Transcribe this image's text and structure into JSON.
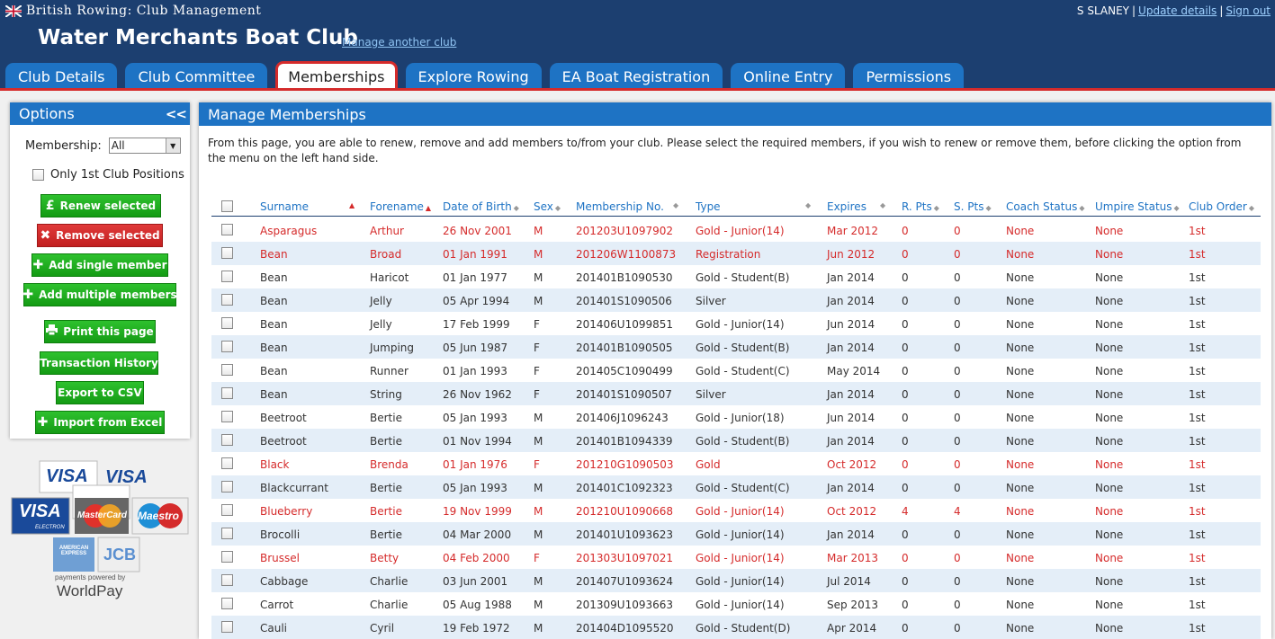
{
  "header": {
    "brand": "British Rowing: Club Management",
    "user_name": "S SLANEY",
    "update_details": "Update details",
    "sign_out": "Sign out",
    "club_name": "Water Merchants Boat Club",
    "manage_another": "Manage another club"
  },
  "tabs": [
    {
      "label": "Club Details"
    },
    {
      "label": "Club Committee"
    },
    {
      "label": "Memberships",
      "active": true
    },
    {
      "label": "Explore Rowing"
    },
    {
      "label": "EA Boat Registration"
    },
    {
      "label": "Online Entry"
    },
    {
      "label": "Permissions"
    }
  ],
  "options": {
    "title": "Options",
    "collapse": "<<",
    "membership_label": "Membership:",
    "membership_value": "All",
    "only_first_club": "Only 1st Club Positions",
    "buttons": {
      "renew": "Renew selected",
      "remove": "Remove selected",
      "add_single": "Add single member",
      "add_multiple": "Add multiple members",
      "print": "Print this page",
      "transactions": "Transaction History",
      "export": "Export to CSV",
      "import": "Import from Excel"
    }
  },
  "cards": {
    "visa1": "VISA",
    "visa2": "VISA",
    "visa_electron": "VISA",
    "electron": "ELECTRON",
    "mastercard": "MasterCard",
    "maestro": "Maestro",
    "amex": "AMERICAN EXPRESS",
    "jcb": "JCB",
    "powered_by": "payments powered by",
    "worldpay": "WorldPay"
  },
  "colors": {
    "header_bg": "#1c3f70",
    "tab_bg": "#1e73c4",
    "accent_red": "#d52b2b",
    "button_green": "#1fae1f"
  },
  "manage": {
    "title": "Manage Memberships",
    "intro": "From this page, you are able to renew, remove and add members to/from your club. Please select the required members, if you wish to renew or remove them, before clicking the option from the menu on the left hand side.",
    "columns": [
      "Surname",
      "Forename",
      "Date of Birth",
      "Sex",
      "Membership No.",
      "Type",
      "Expires",
      "R. Pts",
      "S. Pts",
      "Coach Status",
      "Umpire Status",
      "Club Order"
    ],
    "rows": [
      {
        "surname": "Asparagus",
        "forename": "Arthur",
        "dob": "26 Nov 2001",
        "sex": "M",
        "no": "201203U1097902",
        "type": "Gold - Junior(14)",
        "expires": "Mar 2012",
        "rpts": "0",
        "spts": "0",
        "coach": "None",
        "umpire": "None",
        "order": "1st",
        "expired": true
      },
      {
        "surname": "Bean",
        "forename": "Broad",
        "dob": "01 Jan 1991",
        "sex": "M",
        "no": "201206W1100873",
        "type": "Registration",
        "expires": "Jun 2012",
        "rpts": "0",
        "spts": "0",
        "coach": "None",
        "umpire": "None",
        "order": "1st",
        "expired": true
      },
      {
        "surname": "Bean",
        "forename": "Haricot",
        "dob": "01 Jan 1977",
        "sex": "M",
        "no": "201401B1090530",
        "type": "Gold - Student(B)",
        "expires": "Jan 2014",
        "rpts": "0",
        "spts": "0",
        "coach": "None",
        "umpire": "None",
        "order": "1st",
        "expired": false
      },
      {
        "surname": "Bean",
        "forename": "Jelly",
        "dob": "05 Apr 1994",
        "sex": "M",
        "no": "201401S1090506",
        "type": "Silver",
        "expires": "Jan 2014",
        "rpts": "0",
        "spts": "0",
        "coach": "None",
        "umpire": "None",
        "order": "1st",
        "expired": false
      },
      {
        "surname": "Bean",
        "forename": "Jelly",
        "dob": "17 Feb 1999",
        "sex": "F",
        "no": "201406U1099851",
        "type": "Gold - Junior(14)",
        "expires": "Jun 2014",
        "rpts": "0",
        "spts": "0",
        "coach": "None",
        "umpire": "None",
        "order": "1st",
        "expired": false
      },
      {
        "surname": "Bean",
        "forename": "Jumping",
        "dob": "05 Jun 1987",
        "sex": "F",
        "no": "201401B1090505",
        "type": "Gold - Student(B)",
        "expires": "Jan 2014",
        "rpts": "0",
        "spts": "0",
        "coach": "None",
        "umpire": "None",
        "order": "1st",
        "expired": false
      },
      {
        "surname": "Bean",
        "forename": "Runner",
        "dob": "01 Jan 1993",
        "sex": "F",
        "no": "201405C1090499",
        "type": "Gold - Student(C)",
        "expires": "May 2014",
        "rpts": "0",
        "spts": "0",
        "coach": "None",
        "umpire": "None",
        "order": "1st",
        "expired": false
      },
      {
        "surname": "Bean",
        "forename": "String",
        "dob": "26 Nov 1962",
        "sex": "F",
        "no": "201401S1090507",
        "type": "Silver",
        "expires": "Jan 2014",
        "rpts": "0",
        "spts": "0",
        "coach": "None",
        "umpire": "None",
        "order": "1st",
        "expired": false
      },
      {
        "surname": "Beetroot",
        "forename": "Bertie",
        "dob": "05 Jan 1993",
        "sex": "M",
        "no": "201406J1096243",
        "type": "Gold - Junior(18)",
        "expires": "Jun 2014",
        "rpts": "0",
        "spts": "0",
        "coach": "None",
        "umpire": "None",
        "order": "1st",
        "expired": false
      },
      {
        "surname": "Beetroot",
        "forename": "Bertie",
        "dob": "01 Nov 1994",
        "sex": "M",
        "no": "201401B1094339",
        "type": "Gold - Student(B)",
        "expires": "Jan 2014",
        "rpts": "0",
        "spts": "0",
        "coach": "None",
        "umpire": "None",
        "order": "1st",
        "expired": false
      },
      {
        "surname": "Black",
        "forename": "Brenda",
        "dob": "01 Jan 1976",
        "sex": "F",
        "no": "201210G1090503",
        "type": "Gold",
        "expires": "Oct 2012",
        "rpts": "0",
        "spts": "0",
        "coach": "None",
        "umpire": "None",
        "order": "1st",
        "expired": true
      },
      {
        "surname": "Blackcurrant",
        "forename": "Bertie",
        "dob": "05 Jan 1993",
        "sex": "M",
        "no": "201401C1092323",
        "type": "Gold - Student(C)",
        "expires": "Jan 2014",
        "rpts": "0",
        "spts": "0",
        "coach": "None",
        "umpire": "None",
        "order": "1st",
        "expired": false
      },
      {
        "surname": "Blueberry",
        "forename": "Bertie",
        "dob": "19 Nov 1999",
        "sex": "M",
        "no": "201210U1090668",
        "type": "Gold - Junior(14)",
        "expires": "Oct 2012",
        "rpts": "4",
        "spts": "4",
        "coach": "None",
        "umpire": "None",
        "order": "1st",
        "expired": true
      },
      {
        "surname": "Brocolli",
        "forename": "Bertie",
        "dob": "04 Mar 2000",
        "sex": "M",
        "no": "201401U1093623",
        "type": "Gold - Junior(14)",
        "expires": "Jan 2014",
        "rpts": "0",
        "spts": "0",
        "coach": "None",
        "umpire": "None",
        "order": "1st",
        "expired": false
      },
      {
        "surname": "Brussel",
        "forename": "Betty",
        "dob": "04 Feb 2000",
        "sex": "F",
        "no": "201303U1097021",
        "type": "Gold - Junior(14)",
        "expires": "Mar 2013",
        "rpts": "0",
        "spts": "0",
        "coach": "None",
        "umpire": "None",
        "order": "1st",
        "expired": true
      },
      {
        "surname": "Cabbage",
        "forename": "Charlie",
        "dob": "03 Jun 2001",
        "sex": "M",
        "no": "201407U1093624",
        "type": "Gold - Junior(14)",
        "expires": "Jul 2014",
        "rpts": "0",
        "spts": "0",
        "coach": "None",
        "umpire": "None",
        "order": "1st",
        "expired": false
      },
      {
        "surname": "Carrot",
        "forename": "Charlie",
        "dob": "05 Aug 1988",
        "sex": "M",
        "no": "201309U1093663",
        "type": "Gold - Junior(14)",
        "expires": "Sep 2013",
        "rpts": "0",
        "spts": "0",
        "coach": "None",
        "umpire": "None",
        "order": "1st",
        "expired": false
      },
      {
        "surname": "Cauli",
        "forename": "Cyril",
        "dob": "19 Feb 1972",
        "sex": "M",
        "no": "201404D1095520",
        "type": "Gold - Student(D)",
        "expires": "Apr 2014",
        "rpts": "0",
        "spts": "0",
        "coach": "None",
        "umpire": "None",
        "order": "1st",
        "expired": false
      }
    ]
  }
}
